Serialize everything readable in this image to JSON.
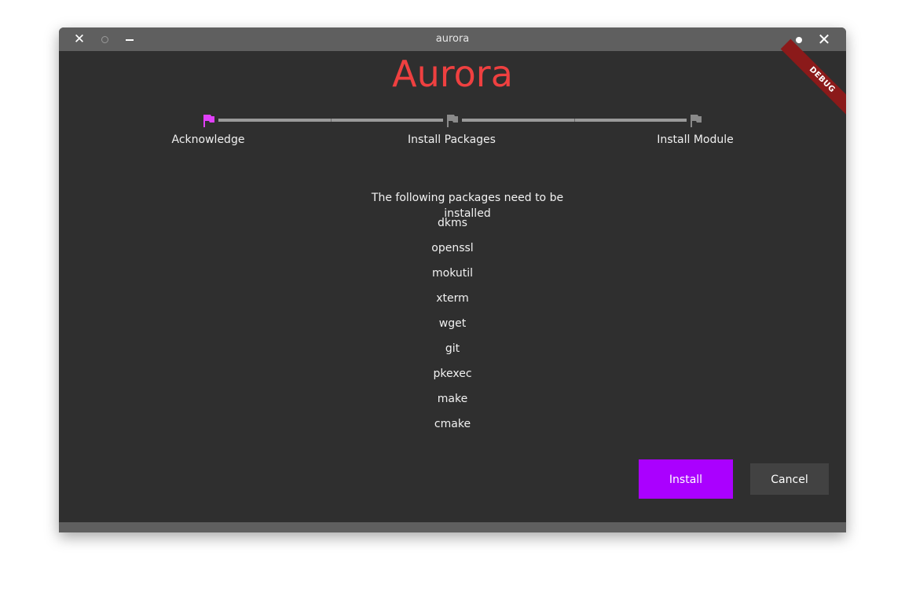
{
  "window": {
    "title": "aurora",
    "close_glyph": "✕",
    "close_glyph_right": "✕"
  },
  "debug_banner": "DEBUG",
  "app_title": "Aurora",
  "colors": {
    "accent": "#aa00ff",
    "active_step": "#e040fb",
    "inactive_step": "#8a8a8a",
    "title": "#ef4040",
    "background": "#2f2f2f"
  },
  "stepper": {
    "steps": [
      {
        "label": "Acknowledge",
        "icon": "flag-icon",
        "active": true
      },
      {
        "label": "Install Packages",
        "icon": "flag-icon",
        "active": false
      },
      {
        "label": "Install Module",
        "icon": "flag-icon",
        "active": false
      }
    ]
  },
  "content": {
    "heading": "The following packages need to be installed",
    "packages": [
      "dkms",
      "openssl",
      "mokutil",
      "xterm",
      "wget",
      "git",
      "pkexec",
      "make",
      "cmake"
    ]
  },
  "actions": {
    "install_label": "Install",
    "cancel_label": "Cancel"
  }
}
